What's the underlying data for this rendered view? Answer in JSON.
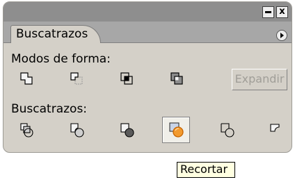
{
  "window": {
    "minimize_glyph": "",
    "close_glyph": "x"
  },
  "panel": {
    "tab_label": "Buscatrazos",
    "shape_modes_label": "Modos de forma:",
    "expand_button_label": "Expandir",
    "pathfinders_label": "Buscatrazos:",
    "shape_modes": [
      {
        "name": "add-to-shape-area-icon"
      },
      {
        "name": "subtract-from-shape-area-icon"
      },
      {
        "name": "intersect-shape-areas-icon"
      },
      {
        "name": "exclude-overlapping-shape-areas-icon"
      }
    ],
    "pathfinders": [
      {
        "name": "divide-icon"
      },
      {
        "name": "trim-icon"
      },
      {
        "name": "merge-icon"
      },
      {
        "name": "crop-icon",
        "active": true
      },
      {
        "name": "outline-icon"
      },
      {
        "name": "minus-back-icon"
      }
    ]
  },
  "tooltip": {
    "text": "Recortar"
  },
  "colors": {
    "panel_bg": "#d4d0c8",
    "titlebar": "#8e8e8e",
    "accent": "#e07a10",
    "tooltip_bg": "#ffffe1"
  }
}
